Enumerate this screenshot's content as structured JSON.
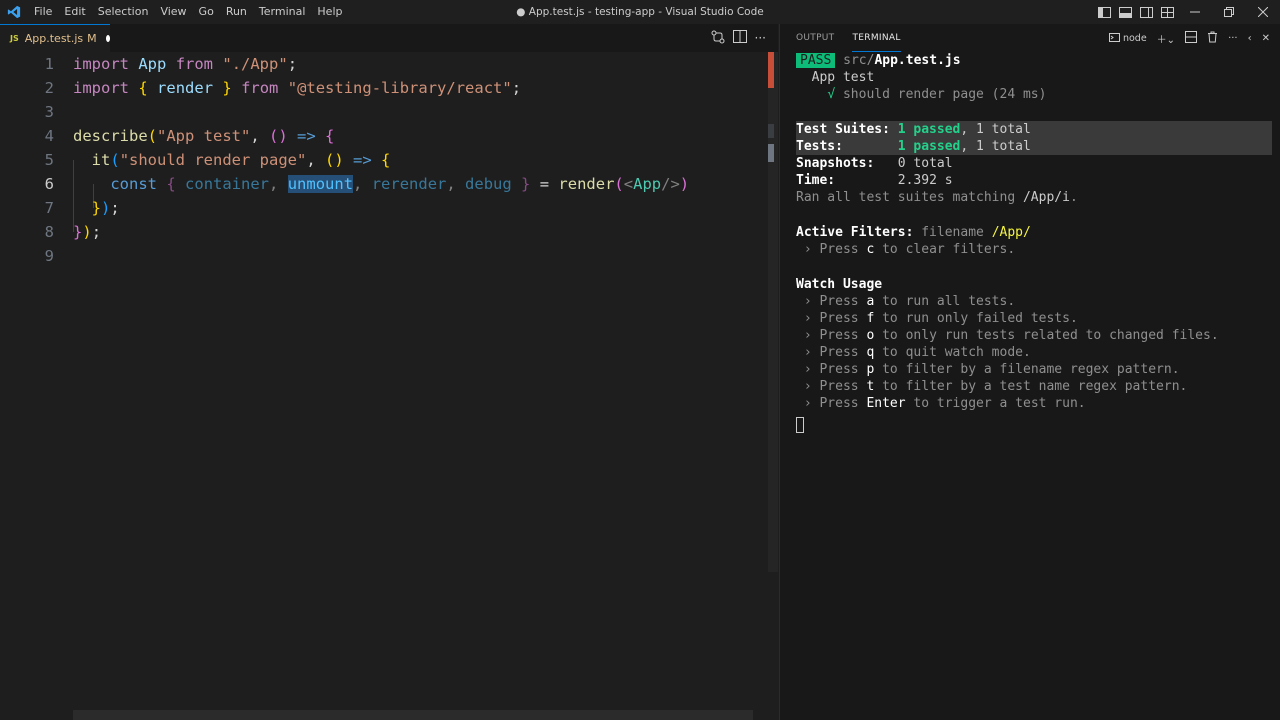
{
  "app": {
    "window_title": "● App.test.js - testing-app - Visual Studio Code",
    "menu": [
      "File",
      "Edit",
      "Selection",
      "View",
      "Go",
      "Run",
      "Terminal",
      "Help"
    ]
  },
  "editor": {
    "tab": {
      "icon_text": "JS",
      "label": "App.test.js",
      "status": "M"
    },
    "line_numbers": [
      "1",
      "2",
      "3",
      "4",
      "5",
      "6",
      "7",
      "8",
      "9"
    ],
    "active_line": "6"
  },
  "panel": {
    "tabs": [
      "OUTPUT",
      "TERMINAL"
    ],
    "active_tab": "TERMINAL",
    "shell_label": "node",
    "terminal": {
      "pass_badge": "PASS",
      "test_path_dir": "src/",
      "test_path_file": "App.test.js",
      "suite_name": "App test",
      "check": "√",
      "test_case": "should render page (24 ms)",
      "suites_label": "Test Suites:",
      "suites_passed": "1 passed",
      "suites_total": ", 1 total",
      "tests_label": "Tests:",
      "tests_passed": "1 passed",
      "tests_total": ", 1 total",
      "snapshots_label": "Snapshots:",
      "snapshots_value": "0 total",
      "time_label": "Time:",
      "time_value": "2.392 s",
      "ran_prefix": "Ran all test suites matching ",
      "ran_pattern": "/App/i",
      "ran_suffix": ".",
      "filters_label": "Active Filters:",
      "filters_key": "filename ",
      "filters_value": "/App/",
      "clear_pre": " › Press ",
      "clear_key": "c",
      "clear_post": " to clear filters.",
      "watch_title": "Watch Usage",
      "watch_items": [
        {
          "key": "a",
          "text": " to run all tests."
        },
        {
          "key": "f",
          "text": " to run only failed tests."
        },
        {
          "key": "o",
          "text": " to only run tests related to changed files."
        },
        {
          "key": "q",
          "text": " to quit watch mode."
        },
        {
          "key": "p",
          "text": " to filter by a filename regex pattern."
        },
        {
          "key": "t",
          "text": " to filter by a test name regex pattern."
        },
        {
          "key": "Enter",
          "text": " to trigger a test run."
        }
      ],
      "press_prefix": " › Press "
    }
  },
  "colors": {
    "accent": "#0078d4",
    "pass_green": "#0dbc79",
    "selection": "#264f78"
  },
  "icons": {
    "logo": "vscode-logo-icon",
    "layout": [
      "toggle-primary-sidebar-icon",
      "toggle-panel-icon",
      "toggle-secondary-sidebar-icon",
      "customize-layout-icon"
    ],
    "window": [
      "minimize-icon",
      "restore-icon",
      "close-icon"
    ]
  }
}
